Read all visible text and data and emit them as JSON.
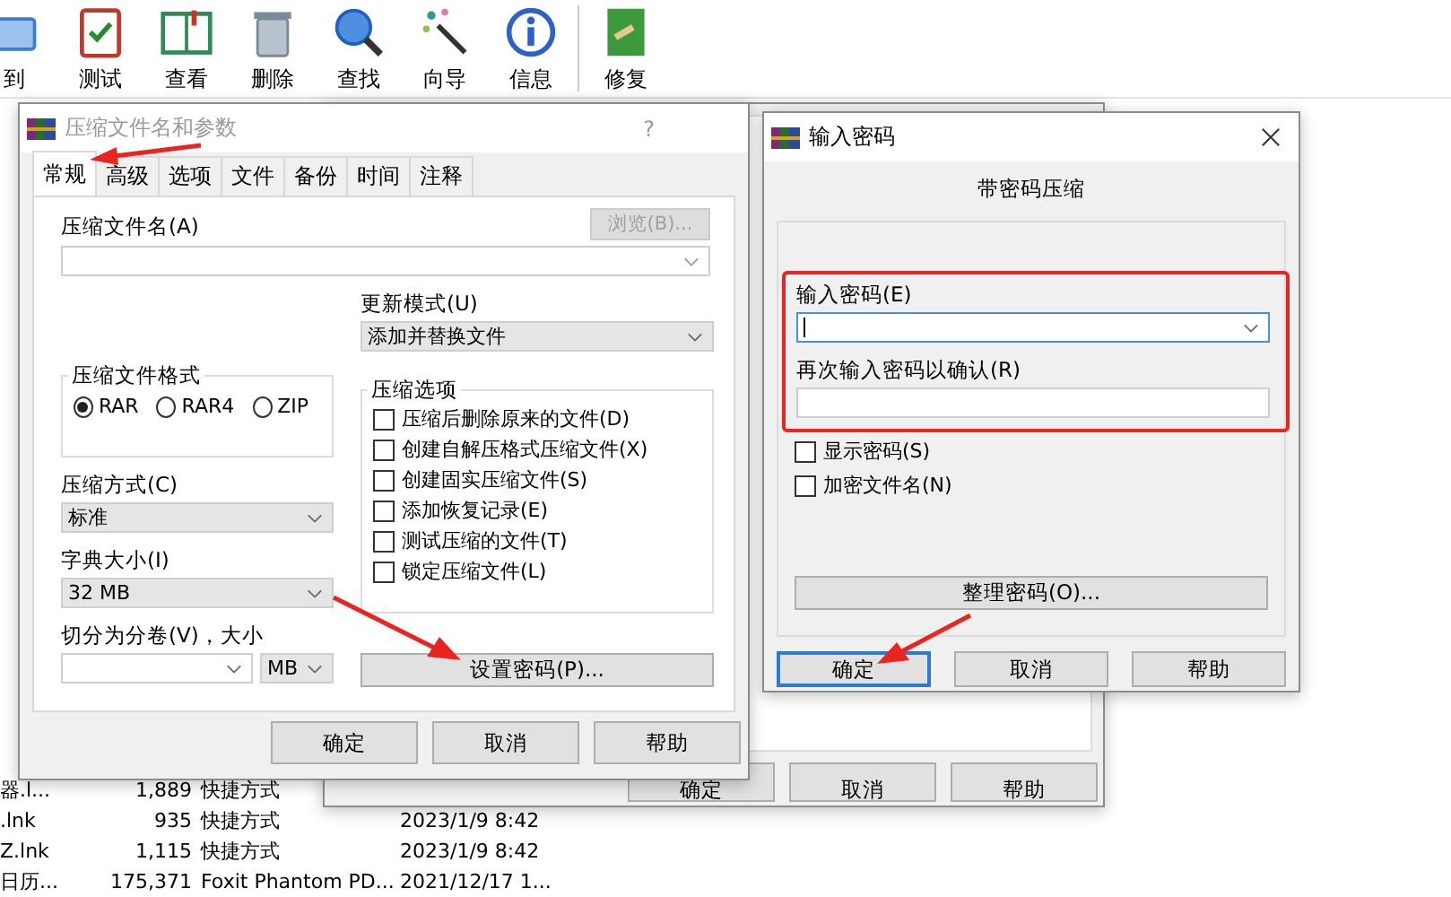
{
  "toolbar": {
    "buttons": [
      {
        "label": "到",
        "kind": "extract"
      },
      {
        "label": "测试",
        "kind": "test"
      },
      {
        "label": "查看",
        "kind": "view"
      },
      {
        "label": "删除",
        "kind": "delete"
      },
      {
        "label": "查找",
        "kind": "find"
      },
      {
        "label": "向导",
        "kind": "wizard"
      },
      {
        "label": "信息",
        "kind": "info"
      },
      {
        "label": "修复",
        "kind": "repair"
      }
    ]
  },
  "file_rows": [
    {
      "name": "器.l...",
      "size": "1,889",
      "type": "快捷方式"
    },
    {
      "name": ".lnk",
      "size": "935",
      "type": "快捷方式",
      "modified": "2023/1/9 8:42"
    },
    {
      "name": "Z.lnk",
      "size": "1,115",
      "type": "快捷方式",
      "modified": "2023/1/9 8:42"
    },
    {
      "name": "日历...",
      "size": "175,371",
      "type": "Foxit Phantom PD...",
      "modified": "2021/12/17 1..."
    }
  ],
  "back_dialog": {
    "buttons": [
      "确定",
      "取消",
      "帮助"
    ]
  },
  "archive_dialog": {
    "title": "压缩文件名和参数",
    "help": "?",
    "tabs": [
      {
        "label": "常规",
        "selected": true
      },
      {
        "label": "高级",
        "selected": false
      },
      {
        "label": "选项",
        "selected": false
      },
      {
        "label": "文件",
        "selected": false
      },
      {
        "label": "备份",
        "selected": false
      },
      {
        "label": "时间",
        "selected": false
      },
      {
        "label": "注释",
        "selected": false
      }
    ],
    "archive_name_label": "压缩文件名(A)",
    "browse_button": {
      "label": "浏览(B)...",
      "disabled": true
    },
    "update_mode": {
      "label": "更新模式(U)",
      "value": "添加并替换文件"
    },
    "format": {
      "title": "压缩文件格式",
      "options": [
        {
          "label": "RAR",
          "selected": true
        },
        {
          "label": "RAR4",
          "selected": false
        },
        {
          "label": "ZIP",
          "selected": false
        }
      ]
    },
    "method": {
      "label": "压缩方式(C)",
      "value": "标准"
    },
    "dictionary": {
      "label": "字典大小(I)",
      "value": "32 MB"
    },
    "split": {
      "label": "切分为分卷(V)，大小",
      "unit": "MB"
    },
    "options": {
      "title": "压缩选项",
      "items": [
        {
          "label": "压缩后删除原来的文件(D)",
          "checked": false
        },
        {
          "label": "创建自解压格式压缩文件(X)",
          "checked": false
        },
        {
          "label": "创建固实压缩文件(S)",
          "checked": false
        },
        {
          "label": "添加恢复记录(E)",
          "checked": false
        },
        {
          "label": "测试压缩的文件(T)",
          "checked": false
        },
        {
          "label": "锁定压缩文件(L)",
          "checked": false
        }
      ]
    },
    "password_button": "设置密码(P)...",
    "buttons": [
      "确定",
      "取消",
      "帮助"
    ]
  },
  "password_dialog": {
    "title": "输入密码",
    "subtitle": "带密码压缩",
    "enter_label": "输入密码(E)",
    "confirm_label": "再次输入密码以确认(R)",
    "checkboxes": [
      {
        "label": "显示密码(S)",
        "checked": false
      },
      {
        "label": "加密文件名(N)",
        "checked": false
      }
    ],
    "organize_button": "整理密码(O)...",
    "buttons": [
      {
        "label": "确定",
        "default": true
      },
      {
        "label": "取消",
        "default": false
      },
      {
        "label": "帮助",
        "default": false
      }
    ]
  }
}
